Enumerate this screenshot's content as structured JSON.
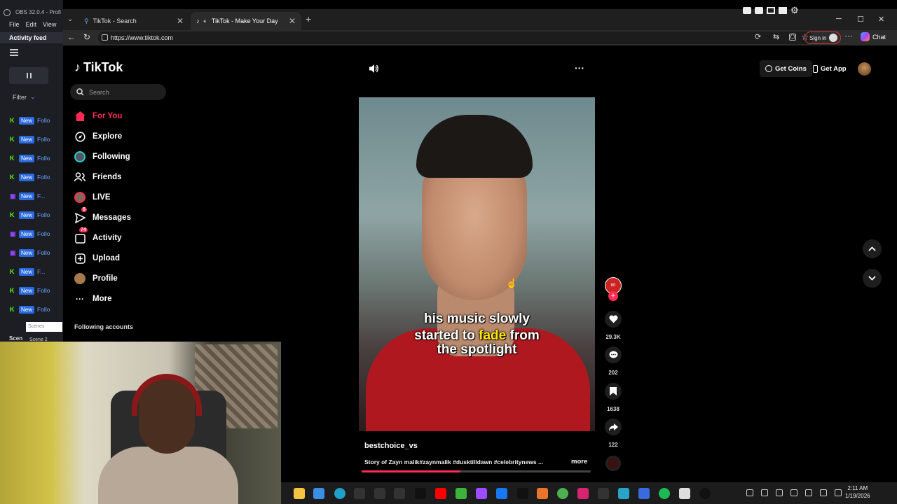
{
  "obs": {
    "title": "OBS 32.0.4 - Profi",
    "menu": [
      "File",
      "Edit",
      "View"
    ],
    "activity_feed": "Activity feed",
    "filter": "Filter",
    "rows": [
      {
        "badge": "New",
        "text": "Follo",
        "platform": "kick"
      },
      {
        "badge": "New",
        "text": "Follo",
        "platform": "kick"
      },
      {
        "badge": "New",
        "text": "Follo",
        "platform": "kick"
      },
      {
        "badge": "New",
        "text": "Follo",
        "platform": "kick"
      },
      {
        "badge": "New",
        "text": "F...",
        "platform": "twitch"
      },
      {
        "badge": "New",
        "text": "Follo",
        "platform": "kick"
      },
      {
        "badge": "New",
        "text": "Follo",
        "platform": "twitch"
      },
      {
        "badge": "New",
        "text": "Follo",
        "platform": "twitch"
      },
      {
        "badge": "New",
        "text": "F...",
        "platform": "kick"
      },
      {
        "badge": "New",
        "text": "Follo",
        "platform": "kick"
      },
      {
        "badge": "New",
        "text": "Follo",
        "platform": "kick"
      }
    ],
    "scenes_label": "Scenes",
    "scene_short": "Scen",
    "scene2": "Scene 2"
  },
  "browser": {
    "tabs": [
      {
        "title": "TikTok - Search",
        "icon": "search-icon"
      },
      {
        "title": "TikTok - Make Your Day",
        "icon": "tiktok-icon"
      }
    ],
    "url": "https://www.tiktok.com",
    "signin": "Sign in",
    "chat": "Chat"
  },
  "tiktok": {
    "logo": "TikTok",
    "search_placeholder": "Search",
    "nav": [
      {
        "label": "For You",
        "icon": "home-icon",
        "active": true
      },
      {
        "label": "Explore",
        "icon": "compass-icon"
      },
      {
        "label": "Following",
        "icon": "following-avatar-icon"
      },
      {
        "label": "Friends",
        "icon": "friends-icon"
      },
      {
        "label": "LIVE",
        "icon": "live-avatar-icon"
      },
      {
        "label": "Messages",
        "icon": "messages-icon",
        "badge": "5"
      },
      {
        "label": "Activity",
        "icon": "activity-icon",
        "badge": "74"
      },
      {
        "label": "Upload",
        "icon": "upload-icon"
      },
      {
        "label": "Profile",
        "icon": "profile-avatar-icon"
      },
      {
        "label": "More",
        "icon": "more-icon"
      }
    ],
    "following_accounts": "Following accounts",
    "get_coins": "Get Coins",
    "get_app": "Get App",
    "video": {
      "caption_line1": "his music slowly",
      "caption_line2_a": "started to ",
      "caption_line2_b": "fade",
      "caption_line2_c": " from",
      "caption_line3": "the spotlight",
      "author": "bestchoice_vs",
      "description": "Story of Zayn malik#zaynmalik #dusktilldawn #celebritynews ...",
      "more": "more",
      "progress": 0.43
    },
    "actions": {
      "likes": "29.3K",
      "comments": "202",
      "saves": "1638",
      "shares": "122"
    },
    "accent": "#fe2c55"
  },
  "taskbar": {
    "time": "2:11 AM",
    "date": "1/19/2026"
  }
}
